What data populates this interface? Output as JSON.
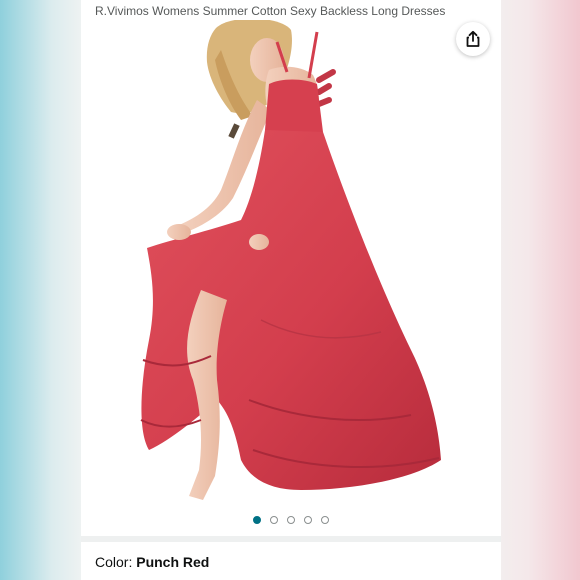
{
  "product": {
    "title": "R.Vivimos Womens Summer Cotton Sexy Backless Long Dresses"
  },
  "share_icon": "share-icon",
  "carousel": {
    "dots": 5,
    "active_index": 0,
    "active_color": "#007185"
  },
  "color": {
    "label": "Color:",
    "value": "Punch Red",
    "swatch": "#d63a4a"
  }
}
